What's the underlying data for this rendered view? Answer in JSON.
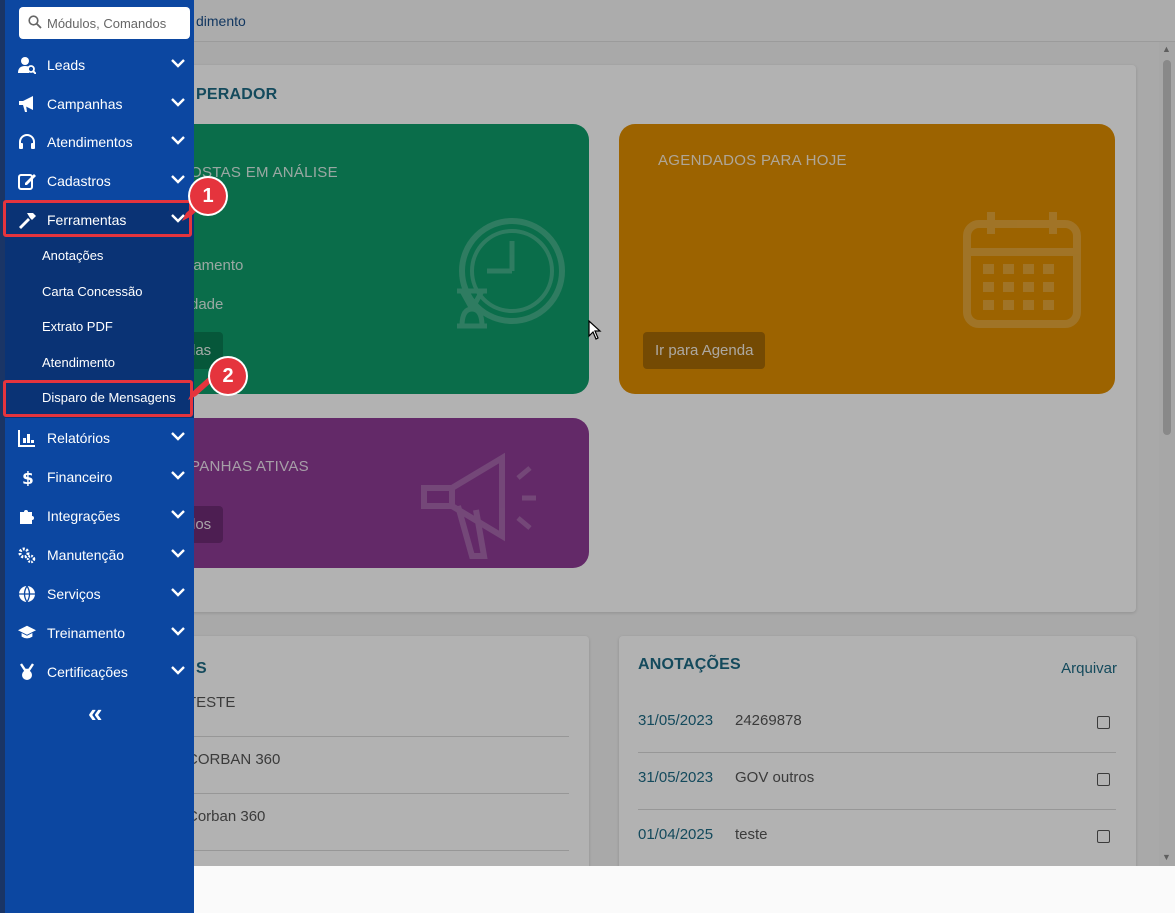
{
  "breadcrumb": "dimento",
  "operator_card": {
    "title": "PERADOR",
    "tiles": [
      {
        "title": "OSTAS EM ANÁLISE",
        "lines": [
          "iamento",
          "dade"
        ],
        "button": "las",
        "icon": "clock-hourglass-icon",
        "color": "#0f9d6a"
      },
      {
        "title": "AGENDADOS PARA HOJE",
        "button": "Ir para Agenda",
        "icon": "calendar-icon",
        "color": "#e08e00"
      },
      {
        "title": "PANHAS ATIVAS",
        "button": "los",
        "icon": "megaphone-icon",
        "color": "#8e3c96"
      }
    ]
  },
  "list_card": {
    "title": "S",
    "rows": [
      "TESTE",
      "CORBAN 360",
      "Corban 360"
    ]
  },
  "notes_card": {
    "title": "ANOTAÇÕES",
    "action": "Arquivar",
    "rows": [
      {
        "date": "31/05/2023",
        "text": "24269878",
        "checked": false
      },
      {
        "date": "31/05/2023",
        "text": "GOV outros",
        "checked": false
      },
      {
        "date": "01/04/2025",
        "text": "teste",
        "checked": false
      }
    ]
  },
  "sidebar": {
    "search_placeholder": "Módulos, Comandos",
    "items": [
      {
        "label": "Leads",
        "icon": "user-search-icon"
      },
      {
        "label": "Campanhas",
        "icon": "megaphone-icon"
      },
      {
        "label": "Atendimentos",
        "icon": "headset-icon"
      },
      {
        "label": "Cadastros",
        "icon": "edit-icon"
      },
      {
        "label": "Ferramentas",
        "icon": "hammer-icon",
        "expanded": true
      },
      {
        "label": "Relatórios",
        "icon": "chart-icon"
      },
      {
        "label": "Financeiro",
        "icon": "dollar-icon"
      },
      {
        "label": "Integrações",
        "icon": "puzzle-icon"
      },
      {
        "label": "Manutenção",
        "icon": "gears-icon"
      },
      {
        "label": "Serviços",
        "icon": "globe-icon"
      },
      {
        "label": "Treinamento",
        "icon": "graduation-cap-icon"
      },
      {
        "label": "Certificações",
        "icon": "medal-icon"
      }
    ],
    "submenu": [
      "Anotações",
      "Carta Concessão",
      "Extrato PDF",
      "Atendimento",
      "Disparo de Mensagens"
    ],
    "collapse_label": "«"
  },
  "annotations": {
    "badge_1": "1",
    "badge_2": "2",
    "color": "#e5343d"
  }
}
